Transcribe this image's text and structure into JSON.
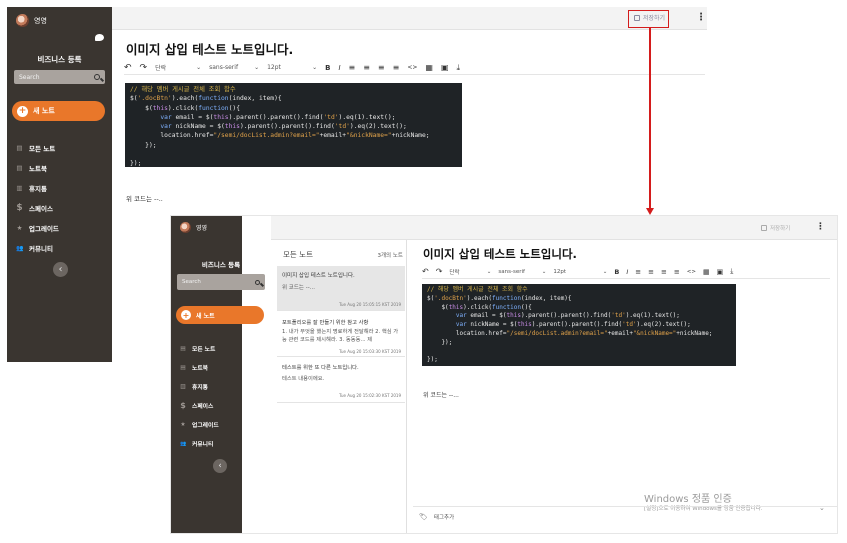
{
  "profile": {
    "name": "영영"
  },
  "sidebar": {
    "business": "비즈니스 등록",
    "search_placeholder": "Search",
    "new_note": "새 노트",
    "items": [
      {
        "icon": "stack-icon",
        "label": "모든 노트"
      },
      {
        "icon": "notebook-icon",
        "label": "노트북"
      },
      {
        "icon": "trash-icon",
        "label": "휴지통"
      },
      {
        "icon": "dollar-icon",
        "label": "스페이스"
      },
      {
        "icon": "star-icon",
        "label": "업그레이드"
      },
      {
        "icon": "people-icon",
        "label": "커뮤니티"
      }
    ],
    "collapse": "‹"
  },
  "topbar": {
    "save": "저장하기",
    "more": "⋮"
  },
  "note": {
    "title": "이미지 삽입 테스트 노트입니다.",
    "after_text_big": "위 코드는 --..",
    "after_text_small": "위 코드는 --..."
  },
  "toolbar": {
    "undo": "↶",
    "redo": "↷",
    "paragraph": "단락",
    "font": "sans-serif",
    "size": "12pt",
    "bold": "B",
    "italic": "I",
    "align_left": "≡",
    "align_center": "≡",
    "align_right": "≡",
    "justify": "≡",
    "code": "<>",
    "table": "▦",
    "image": "▣",
    "download": "⤓"
  },
  "code": {
    "line1": "// 해당 멤버 게시글 전체 조회 함수",
    "line2a": "$(",
    "line2b": "'.docBtn'",
    "line2c": ").each(",
    "line2d": "function",
    "line2e": "(index, item){",
    "line3a": "    $(",
    "line3b": "this",
    "line3c": ").click(",
    "line3d": "function",
    "line3e": "(){",
    "line4a": "        var",
    "line4b": " email = $(",
    "line4c": "this",
    "line4d": ").parent().parent().find(",
    "line4e": "'td'",
    "line4f": ").eq(1).text();",
    "line5a": "        var",
    "line5b": " nickName = $(",
    "line5c": "this",
    "line5d": ").parent().parent().find(",
    "line5e": "'td'",
    "line5f": ").eq(2).text();",
    "line6a": "        location.href=",
    "line6b": "\"/semi/docList.admin?email=\"",
    "line6c": "+email+",
    "line6d": "\"&nickName=\"",
    "line6e": "+nickName;",
    "line7": "    });",
    "line8": "});"
  },
  "notes_list": {
    "title": "모든 노트",
    "count": "3개의 노트",
    "items": [
      {
        "title": "이미지 삽입 테스트 노트입니다.",
        "preview": "위 코드는 --...",
        "date": "Tue Aug 20 15:05:15 KST 2019"
      },
      {
        "title": "포트폴리오를 잘 만들기 위한 참고 사항",
        "preview": "1. 내가 무엇을 했는지 명료하게 전달해라 2. 핵심 가능 관련 코드를 제시해라. 3. 동동동... 제",
        "date": "Tue Aug 20 15:03:30 KST 2019"
      },
      {
        "title": "테스트를 위한 또 다른 노트입니다.",
        "preview": "테스트 내용이에요.",
        "date": "Tue Aug 20 15:02:30 KST 2019"
      }
    ]
  },
  "tagbar": {
    "label": "태그추가"
  },
  "watermark": {
    "line1": "Windows 정품 인증",
    "line2": "[설정]으로 이동하여 Windows를 정품 인증합니다."
  }
}
